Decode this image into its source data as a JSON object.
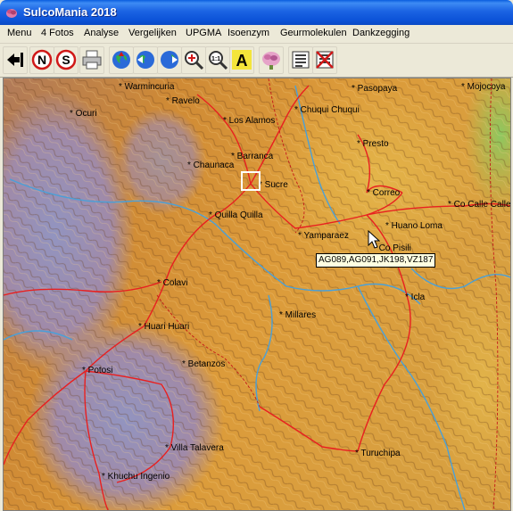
{
  "window": {
    "title": "SulcoMania 2018"
  },
  "menu": [
    "Menu",
    "4 Fotos",
    "Analyse",
    "Vergelijken",
    "UPGMA",
    "Isoenzym",
    "Geurmolekulen",
    "Dankzegging"
  ],
  "toolbar": {
    "buttons": [
      "back-arrow-icon",
      "n-circle-icon",
      "s-circle-icon",
      "print-icon",
      "globe-icon",
      "globe-left-icon",
      "globe-right-icon",
      "zoom-in-icon",
      "zoom-1-1-icon",
      "text-a-icon",
      "flower-icon",
      "list-icon",
      "no-list-icon"
    ]
  },
  "map": {
    "places": [
      {
        "name": "Warmincuria"
      },
      {
        "name": "Pasopaya"
      },
      {
        "name": "Mojocoya"
      },
      {
        "name": "Ravelo"
      },
      {
        "name": "Ocuri"
      },
      {
        "name": "Chuqui Chuqui"
      },
      {
        "name": "Los Alamos"
      },
      {
        "name": "Presto"
      },
      {
        "name": "Barranca"
      },
      {
        "name": "Chaunaca"
      },
      {
        "name": "Sucre"
      },
      {
        "name": "Correo"
      },
      {
        "name": "Co Calle Calle"
      },
      {
        "name": "Quilla Quilla"
      },
      {
        "name": "Huano Loma"
      },
      {
        "name": "Yamparaez"
      },
      {
        "name": "Co Pisili"
      },
      {
        "name": "Colavi"
      },
      {
        "name": "Icla"
      },
      {
        "name": "Millares"
      },
      {
        "name": "Huari Huari"
      },
      {
        "name": "Potosi"
      },
      {
        "name": "Betanzos"
      },
      {
        "name": "Villa Talavera"
      },
      {
        "name": "Turuchipa"
      },
      {
        "name": "Khuchu Ingenio"
      }
    ],
    "tooltip": "AG089,AG091,JK198,VZ187",
    "colors": {
      "highland": "#8d8fb8",
      "midland": "#c8752c",
      "lowland": "#e0a63a",
      "road": "#e82020",
      "river": "#4aa0d8"
    }
  }
}
